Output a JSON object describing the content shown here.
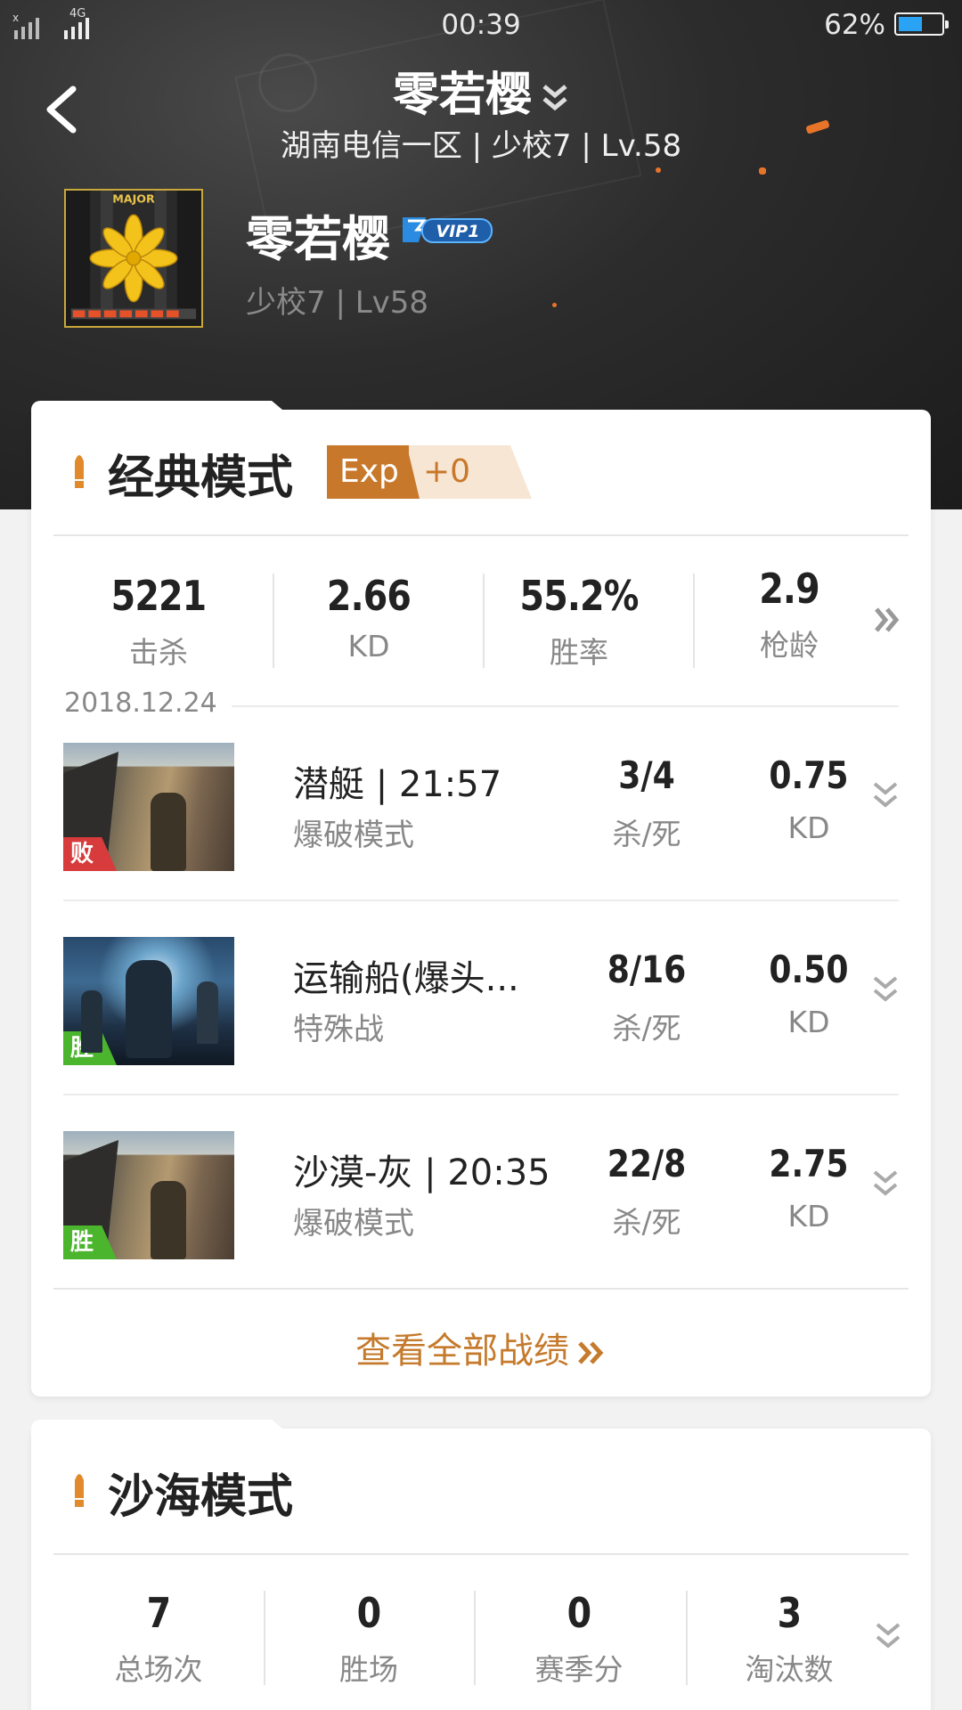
{
  "status_bar": {
    "signal_label": "4G",
    "time": "00:39",
    "battery_text": "62%",
    "battery_level": 0.62
  },
  "header": {
    "title": "零若樱",
    "subtitle": "湖南电信一区 | 少校7 | Lv.58"
  },
  "profile": {
    "rank_badge_text": "MAJOR",
    "name": "零若樱",
    "vip": "VIP1",
    "rank_line": "少校7 | Lv58"
  },
  "classic": {
    "title": "经典模式",
    "exp_label": "Exp",
    "exp_value": "+0",
    "stats": [
      {
        "value": "5221",
        "label": "击杀"
      },
      {
        "value": "2.66",
        "label": "KD"
      },
      {
        "value": "55.2%",
        "label": "胜率"
      },
      {
        "value": "2.9",
        "label": "枪龄"
      }
    ],
    "date": "2018.12.24",
    "matches": [
      {
        "map": "潜艇 | 21:57",
        "mode": "爆破模式",
        "kd_ratio": "3/4",
        "kd_ratio_label": "杀/死",
        "kd": "0.75",
        "kd_label": "KD",
        "result": "败",
        "thumb": "desert"
      },
      {
        "map": "运输船(爆头...",
        "mode": "特殊战",
        "kd_ratio": "8/16",
        "kd_ratio_label": "杀/死",
        "kd": "0.50",
        "kd_label": "KD",
        "result": "胜",
        "thumb": "ship"
      },
      {
        "map": "沙漠-灰 | 20:35",
        "mode": "爆破模式",
        "kd_ratio": "22/8",
        "kd_ratio_label": "杀/死",
        "kd": "2.75",
        "kd_label": "KD",
        "result": "胜",
        "thumb": "desert"
      }
    ],
    "view_all": "查看全部战绩"
  },
  "sandsea": {
    "title": "沙海模式",
    "stats": [
      {
        "value": "7",
        "label": "总场次"
      },
      {
        "value": "0",
        "label": "胜场"
      },
      {
        "value": "0",
        "label": "赛季分"
      },
      {
        "value": "3",
        "label": "淘汰数"
      }
    ]
  },
  "colors": {
    "accent": "#c8782a",
    "win": "#4bb52d",
    "lose": "#d73b3b",
    "battery": "#2aa3f5"
  }
}
